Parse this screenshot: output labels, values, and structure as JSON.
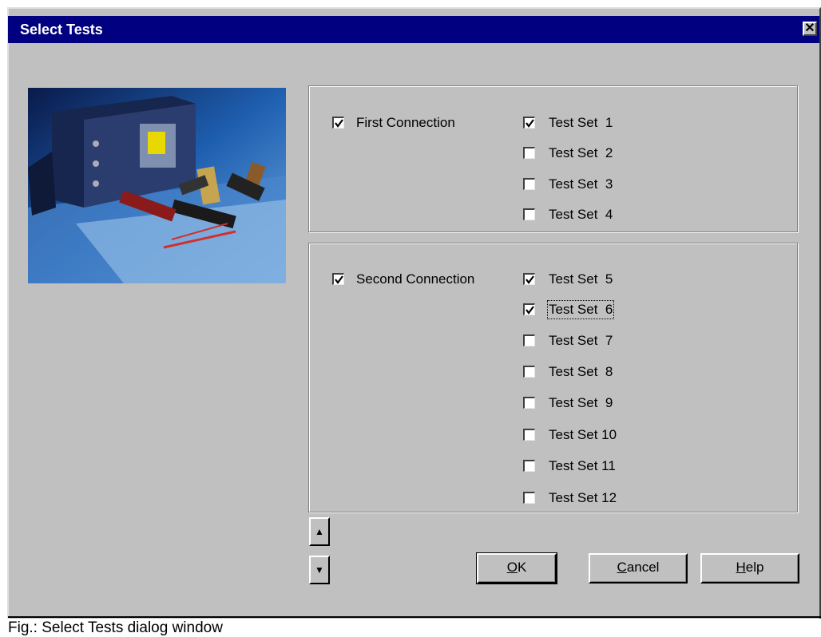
{
  "window": {
    "title": "Select Tests",
    "close_glyph": "✕"
  },
  "image": {
    "name": "measurement-equipment-photo"
  },
  "groups": [
    {
      "connection": {
        "label": "First Connection",
        "checked": true
      },
      "tests": [
        {
          "label": "Test Set  1",
          "checked": true
        },
        {
          "label": "Test Set  2",
          "checked": false
        },
        {
          "label": "Test Set  3",
          "checked": false
        },
        {
          "label": "Test Set  4",
          "checked": false
        }
      ]
    },
    {
      "connection": {
        "label": "Second Connection",
        "checked": true
      },
      "tests": [
        {
          "label": "Test Set  5",
          "checked": true
        },
        {
          "label": "Test Set  6",
          "checked": true
        },
        {
          "label": "Test Set  7",
          "checked": false
        },
        {
          "label": "Test Set  8",
          "checked": false
        },
        {
          "label": "Test Set  9",
          "checked": false
        },
        {
          "label": "Test Set 10",
          "checked": false
        },
        {
          "label": "Test Set 11",
          "checked": false
        },
        {
          "label": "Test Set 12",
          "checked": false
        }
      ]
    }
  ],
  "buttons": {
    "ok": {
      "mnemonic": "O",
      "rest": "K"
    },
    "cancel": {
      "mnemonic": "C",
      "rest": "ancel"
    },
    "help": {
      "mnemonic": "H",
      "rest": "elp"
    }
  },
  "scroll": {
    "up_glyph": "▲",
    "down_glyph": "▼"
  },
  "caption": "Fig.: Select Tests dialog window",
  "colors": {
    "titlebar": "#000080",
    "face": "#c0c0c0"
  }
}
